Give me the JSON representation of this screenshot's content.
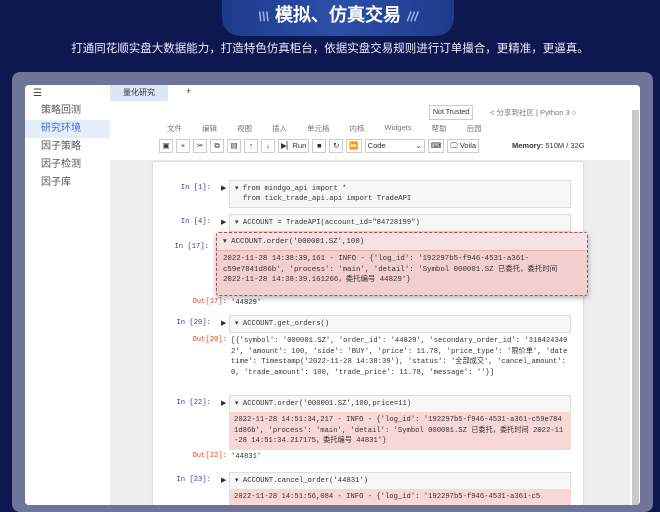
{
  "hero": {
    "title": "模拟、仿真交易",
    "subtitle": "打通同花顺实盘大数据能力，打造特色仿真柜台，依据实盘交易规则进行订单撮合，更精准，更逼真。"
  },
  "sidebar": {
    "items": [
      {
        "label": "策略回测"
      },
      {
        "label": "研究环境"
      },
      {
        "label": "因子策略"
      },
      {
        "label": "因子检测"
      },
      {
        "label": "因子库"
      }
    ]
  },
  "tabs": {
    "active": "量化研究",
    "add": "+"
  },
  "notebook": {
    "not_trusted": "Not Trusted",
    "share": "分享到社区",
    "kernel": "Python 3",
    "menu": [
      "文件",
      "编辑",
      "视图",
      "插入",
      "单元格",
      "内核",
      "Widgets",
      "帮助",
      "后园"
    ],
    "run": "Run",
    "cell_type": "Code",
    "voila": "Voila",
    "memory_label": "Memory:",
    "memory_value": "510M / 32G"
  },
  "cells": [
    {
      "prompt": "In [1]:",
      "code1": "from mindgo_api import *",
      "code2": "from tick_trade_api.api import TradeAPI"
    },
    {
      "prompt": "In [4]:",
      "code": "ACCOUNT = TradeAPI(account_id=\"84728199\")"
    },
    {
      "prompt": "In [17]:",
      "code": "ACCOUNT.order('000001.SZ',100)",
      "stderr": "2022-11-28 14:38:39,161 - INFO - {'log_id': '192297b5-f946-4531-a361-c59e7841d86b', 'process': 'main', 'detail': 'Symbol 000001.SZ 已委托，委托时间 2022-11-28 14:38:39.161266，委托编号 44829'}",
      "out_prompt": "Out[17]:",
      "out": "'44829'"
    },
    {
      "prompt": "In [20]:",
      "code": "ACCOUNT.get_orders()",
      "out_prompt": "Out[20]:",
      "out": "[{'symbol': '000001.SZ', 'order_id': '44829', 'secondary_order_id': '3184243402', 'amount': 100, 'side': 'BUY', 'price': 11.78, 'price_type': '限价单', 'datetime': Timestamp('2022-11-28 14:38:39'), 'status': '全部成交', 'cancel_amount': 0, 'trade_amount': 100, 'trade_price': 11.78, 'message': ''}]"
    },
    {
      "prompt": "In [22]:",
      "code": "ACCOUNT.order('000001.SZ',100,price=11)",
      "stderr": "2022-11-28 14:51:34,217 - INFO - {'log_id': '192297b5-f946-4531-a361-c59e7841d86b', 'process': 'main', 'detail': 'Symbol 000001.SZ 已委托，委托时间 2022-11-28 14:51:34.217175，委托编号 44831'}",
      "out_prompt": "Out[22]:",
      "out": "'44831'"
    },
    {
      "prompt": "In [23]:",
      "code": "ACCOUNT.cancel_order('44831')",
      "stderr": "2022-11-28 14:51:56,084 - INFO - {'log_id': '192297b5-f946-4531-a361-c5"
    }
  ]
}
